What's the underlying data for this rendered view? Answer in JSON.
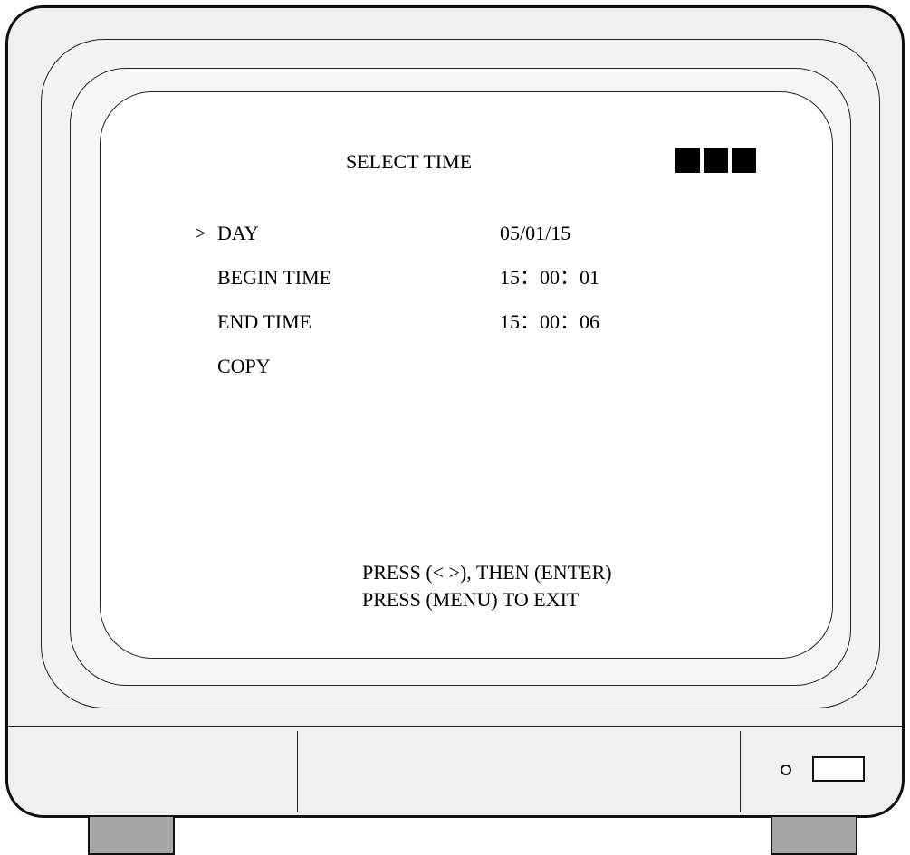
{
  "menu": {
    "title": "SELECT TIME",
    "cursor": ">",
    "indicator": {
      "blocks": 3,
      "color": "#000000"
    },
    "items": [
      {
        "label": "DAY",
        "value": "05/01/15",
        "selected": true
      },
      {
        "label": "BEGIN TIME",
        "value": "15：00：01",
        "selected": false
      },
      {
        "label": "END TIME",
        "value": "15：00：06",
        "selected": false
      },
      {
        "label": "COPY",
        "value": "",
        "selected": false
      }
    ]
  },
  "hints": {
    "line1": "PRESS (< >), THEN (ENTER)",
    "line2": "PRESS (MENU) TO EXIT"
  },
  "colors": {
    "casing": "#f0f0f0",
    "screen": "#ffffff",
    "feet": "#a6a6a6",
    "text": "#000000"
  }
}
